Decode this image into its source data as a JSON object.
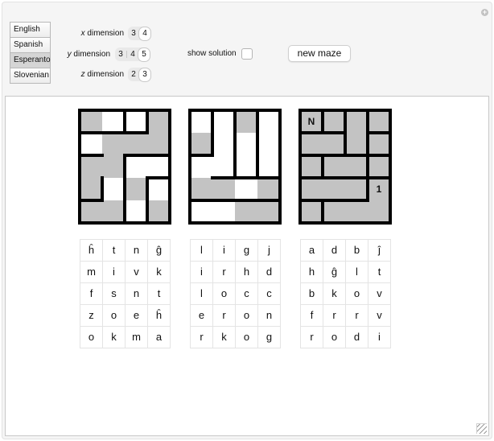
{
  "controls": {
    "languages": [
      "English",
      "Spanish",
      "Esperanto",
      "Slovenian"
    ],
    "selected_language": "Esperanto",
    "x_dimension": {
      "var": "x",
      "label": " dimension",
      "options": [
        "3",
        "4"
      ],
      "selected": "4"
    },
    "y_dimension": {
      "var": "y",
      "label": " dimension",
      "options": [
        "3",
        "4",
        "5"
      ],
      "selected": "5"
    },
    "z_dimension": {
      "var": "z",
      "label": " dimension",
      "options": [
        "2",
        "3"
      ],
      "selected": "3"
    },
    "show_solution_label": "show solution",
    "show_solution_checked": false,
    "new_maze_label": "new maze"
  },
  "mazes": [
    {
      "shading": [
        [
          "g",
          "w",
          "w",
          "g"
        ],
        [
          "w",
          "g",
          "g",
          "g"
        ],
        [
          "g",
          "g",
          "w",
          "w"
        ],
        [
          "g",
          "w",
          "g",
          "w"
        ],
        [
          "g",
          "g",
          "w",
          "g"
        ]
      ],
      "vwalls": [
        [
          0,
          1,
          1
        ],
        [
          0,
          0,
          0
        ],
        [
          0,
          1,
          0
        ],
        [
          1,
          1,
          1
        ],
        [
          0,
          1,
          1
        ]
      ],
      "hwalls": [
        [
          1,
          1,
          1,
          0
        ],
        [
          1,
          0,
          1,
          1
        ],
        [
          0,
          0,
          0,
          1
        ],
        [
          1,
          0,
          0,
          0
        ]
      ],
      "marks": []
    },
    {
      "shading": [
        [
          "w",
          "w",
          "g",
          "w"
        ],
        [
          "g",
          "w",
          "w",
          "w"
        ],
        [
          "w",
          "w",
          "w",
          "w"
        ],
        [
          "g",
          "g",
          "w",
          "g"
        ],
        [
          "w",
          "w",
          "g",
          "g"
        ]
      ],
      "vwalls": [
        [
          1,
          1,
          1
        ],
        [
          1,
          1,
          1
        ],
        [
          0,
          1,
          1
        ],
        [
          0,
          0,
          0
        ],
        [
          0,
          0,
          0
        ]
      ],
      "hwalls": [
        [
          0,
          0,
          0,
          0
        ],
        [
          1,
          0,
          0,
          0
        ],
        [
          0,
          1,
          1,
          1
        ],
        [
          1,
          1,
          1,
          1
        ]
      ],
      "marks": []
    },
    {
      "shading": [
        [
          "g",
          "g",
          "g",
          "g"
        ],
        [
          "g",
          "g",
          "g",
          "g"
        ],
        [
          "g",
          "g",
          "g",
          "g"
        ],
        [
          "g",
          "g",
          "g",
          "g"
        ],
        [
          "g",
          "g",
          "g",
          "g"
        ]
      ],
      "vwalls": [
        [
          1,
          1,
          1
        ],
        [
          0,
          1,
          1
        ],
        [
          1,
          0,
          1
        ],
        [
          0,
          0,
          1
        ],
        [
          1,
          0,
          0
        ]
      ],
      "hwalls": [
        [
          1,
          1,
          0,
          1
        ],
        [
          1,
          1,
          1,
          1
        ],
        [
          1,
          1,
          1,
          1
        ],
        [
          1,
          1,
          1,
          0
        ]
      ],
      "marks": [
        {
          "row": 0,
          "col": 0,
          "text": "N"
        },
        {
          "row": 3,
          "col": 3,
          "text": "1"
        }
      ]
    }
  ],
  "letter_grids": [
    [
      [
        "ĥ",
        "t",
        "n",
        "ĝ"
      ],
      [
        "m",
        "i",
        "v",
        "k"
      ],
      [
        "f",
        "s",
        "n",
        "t"
      ],
      [
        "z",
        "o",
        "e",
        "ĥ"
      ],
      [
        "o",
        "k",
        "m",
        "a"
      ]
    ],
    [
      [
        "l",
        "i",
        "g",
        "j"
      ],
      [
        "i",
        "r",
        "h",
        "d"
      ],
      [
        "l",
        "o",
        "c",
        "c"
      ],
      [
        "e",
        "r",
        "o",
        "n"
      ],
      [
        "r",
        "k",
        "o",
        "g"
      ]
    ],
    [
      [
        "a",
        "d",
        "b",
        "ĵ"
      ],
      [
        "h",
        "ĝ",
        "l",
        "t"
      ],
      [
        "b",
        "k",
        "o",
        "v"
      ],
      [
        "f",
        "r",
        "r",
        "v"
      ],
      [
        "r",
        "o",
        "d",
        "i"
      ]
    ]
  ]
}
